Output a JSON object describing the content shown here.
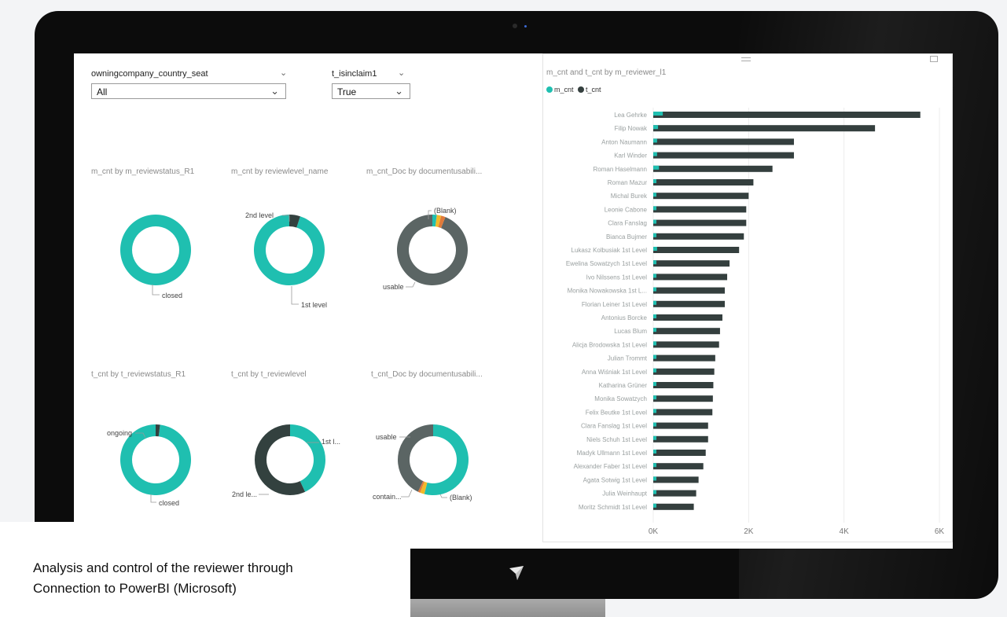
{
  "caption": {
    "line1": "Analysis and control of the reviewer through",
    "line2": "Connection to PowerBI (Microsoft)"
  },
  "slicers": [
    {
      "label": "owningcompany_country_seat",
      "value": "All",
      "chevron": "chevron-down-icon"
    },
    {
      "label": "t_isinclaim1",
      "value": "True",
      "chevron": "chevron-down-icon"
    }
  ],
  "donuts": [
    {
      "title": "m_cnt by m_reviewstatus_R1",
      "labels": [
        "closed"
      ],
      "slices": [
        {
          "label": "closed",
          "value": 100,
          "color": "#1fbfb0"
        }
      ]
    },
    {
      "title": "m_cnt by reviewlevel_name",
      "labels": [
        "2nd level",
        "1st level"
      ],
      "slices": [
        {
          "label": "2nd level",
          "value": 5,
          "color": "#33413f"
        },
        {
          "label": "1st level",
          "value": 95,
          "color": "#1fbfb0"
        }
      ]
    },
    {
      "title": "m_cnt_Doc by documentusabili...",
      "labels": [
        "(Blank)",
        "usable"
      ],
      "slices": [
        {
          "label": "(Blank)",
          "value": 2,
          "color": "#1fbfb0"
        },
        {
          "label": "",
          "value": 2,
          "color": "#f1b929"
        },
        {
          "label": "",
          "value": 2,
          "color": "#e07a3a"
        },
        {
          "label": "usable",
          "value": 94,
          "color": "#5b6564"
        }
      ]
    },
    {
      "title": "t_cnt by t_reviewstatus_R1",
      "labels": [
        "ongoing",
        "closed"
      ],
      "slices": [
        {
          "label": "ongoing",
          "value": 2,
          "color": "#33413f"
        },
        {
          "label": "closed",
          "value": 98,
          "color": "#1fbfb0"
        }
      ]
    },
    {
      "title": "t_cnt by t_reviewlevel",
      "labels": [
        "1st l...",
        "2nd le..."
      ],
      "slices": [
        {
          "label": "1st l...",
          "value": 43,
          "color": "#1fbfb0"
        },
        {
          "label": "2nd le...",
          "value": 57,
          "color": "#33413f"
        }
      ]
    },
    {
      "title": "t_cnt_Doc by documentusabili...",
      "labels": [
        "usable",
        "contain...",
        "(Blank)"
      ],
      "slices": [
        {
          "label": "(Blank)",
          "value": 54,
          "color": "#1fbfb0"
        },
        {
          "label": "contain...",
          "value": 2,
          "color": "#f1b929"
        },
        {
          "label": "",
          "value": 1,
          "color": "#e07a3a"
        },
        {
          "label": "usable",
          "value": 43,
          "color": "#5b6564"
        }
      ]
    }
  ],
  "chart_data": {
    "type": "bar",
    "orientation": "horizontal",
    "title": "m_cnt and t_cnt by m_reviewer_l1",
    "legend_placement": "top-left",
    "xlim": [
      0,
      6000
    ],
    "x_ticks": [
      "0K",
      "2K",
      "4K",
      "6K"
    ],
    "categories": [
      "Lea Gehrke",
      "Filip Nowak",
      "Anton Naumann",
      "Karl Winder",
      "Roman Haselmann",
      "Roman Mazur",
      "Michal Burek",
      "Leonie Cabone",
      "Clara Fanslag",
      "Bianca Bujmer",
      "Lukasz Kolbusiak 1st Level",
      "Ewelina Sowatzych 1st Level",
      "Ivo Nilssens 1st Level",
      "Monika Nowakowska 1st L...",
      "Florian Leiner 1st Level",
      "Antonius Borcke",
      "Lucas Blum",
      "Alicja Brodowska 1st Level",
      "Julian Trommt",
      "Anna Wiśniak 1st Level",
      "Katharina Grüner",
      "Monika Sowatzych",
      "Felix Beutke 1st Level",
      "Clara Fanslag 1st Level",
      "Niels Schuh 1st Level",
      "Madyk Ullmann 1st Level",
      "Alexander Faber 1st Level",
      "Agata Sotwig 1st Level",
      "Julia Weinhaupt",
      "Moritz Schmidt 1st Level"
    ],
    "series": [
      {
        "name": "m_cnt",
        "color": "#1fbfb0",
        "values": [
          200,
          100,
          80,
          80,
          120,
          60,
          60,
          60,
          60,
          60,
          80,
          60,
          60,
          60,
          60,
          60,
          60,
          60,
          50,
          50,
          50,
          50,
          50,
          50,
          50,
          50,
          50,
          50,
          50,
          50
        ]
      },
      {
        "name": "t_cnt",
        "color": "#343f3e",
        "values": [
          5600,
          4650,
          2950,
          2950,
          2500,
          2100,
          2000,
          1950,
          1950,
          1900,
          1800,
          1600,
          1550,
          1500,
          1500,
          1450,
          1400,
          1380,
          1300,
          1280,
          1260,
          1250,
          1240,
          1150,
          1150,
          1100,
          1050,
          950,
          900,
          850
        ]
      }
    ]
  }
}
